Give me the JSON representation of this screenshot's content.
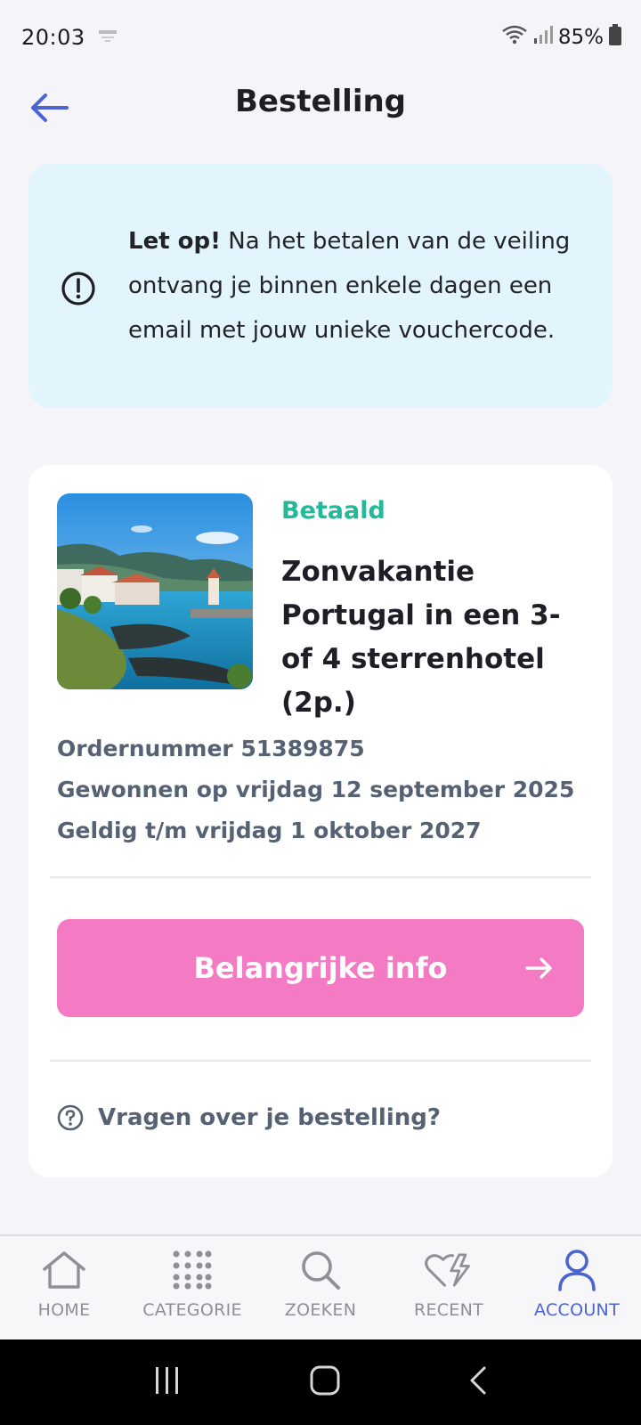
{
  "status_bar": {
    "time": "20:03",
    "battery_percent": "85%",
    "icons": [
      "wifi-icon",
      "signal-icon",
      "battery-icon"
    ]
  },
  "header": {
    "title": "Bestelling"
  },
  "notice": {
    "bold": "Let op!",
    "text": " Na het betalen van de veiling ontvang je binnen enkele dagen een email met jouw unieke vouchercode."
  },
  "order": {
    "status": "Betaald",
    "title": "Zonvakantie Portugal in een 3- of 4 sterrenhotel (2p.)",
    "order_number": "Ordernummer 51389875",
    "won_on": "Gewonnen op vrijdag 12 september 2025",
    "valid_until": "Geldig t/m vrijdag 1 oktober 2027",
    "info_button": "Belangrijke info",
    "questions_link": "Vragen over je bestelling?"
  },
  "bottom_nav": {
    "items": [
      {
        "label": "HOME",
        "icon": "home-icon",
        "active": false
      },
      {
        "label": "CATEGORIE",
        "icon": "grid-icon",
        "active": false
      },
      {
        "label": "ZOEKEN",
        "icon": "search-icon",
        "active": false
      },
      {
        "label": "RECENT",
        "icon": "heart-bolt-icon",
        "active": false
      },
      {
        "label": "ACCOUNT",
        "icon": "user-icon",
        "active": true
      }
    ]
  },
  "colors": {
    "accent": "#4a64d2",
    "status_paid": "#22b89a",
    "info_button": "#f47ac4",
    "notice_bg": "#e2f5fc"
  }
}
